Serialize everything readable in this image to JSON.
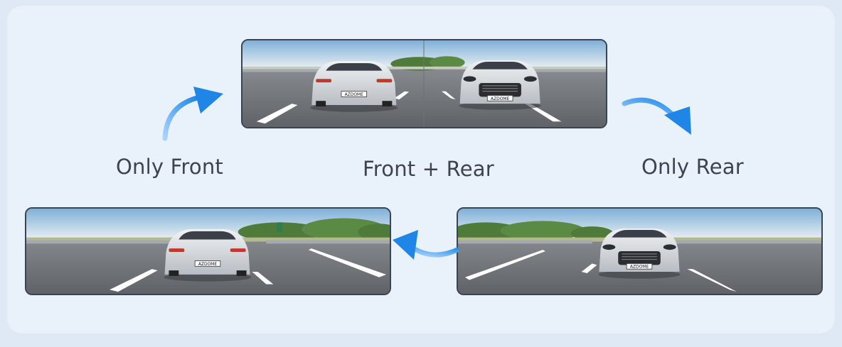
{
  "modes": {
    "front_label": "Only Front",
    "dual_label": "Front + Rear",
    "rear_label": "Only Rear"
  },
  "plate_text": "AZDOME",
  "colors": {
    "arrow": "#1f86e8",
    "label": "#3d4450",
    "frame": "#3a4454"
  }
}
